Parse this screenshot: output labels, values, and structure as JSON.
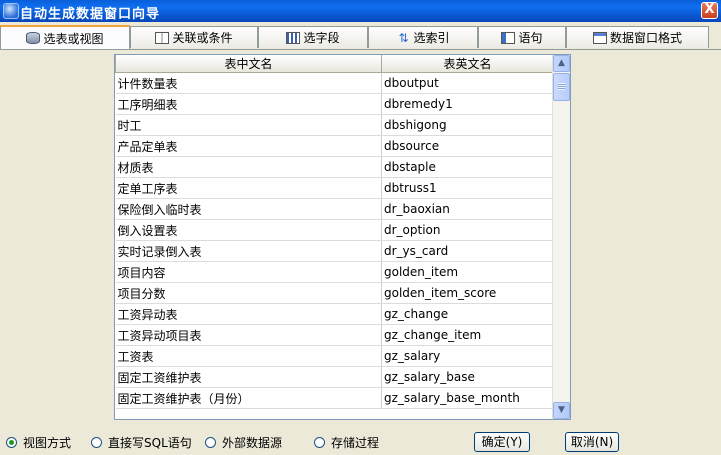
{
  "window": {
    "title": "自动生成数据窗口向导",
    "close_label": "X"
  },
  "tabs": [
    {
      "label": "选表或视图",
      "icon": "database-icon"
    },
    {
      "label": "关联或条件",
      "icon": "grid-icon"
    },
    {
      "label": "选字段",
      "icon": "columns-icon"
    },
    {
      "label": "选索引",
      "icon": "sort-icon"
    },
    {
      "label": "语句",
      "icon": "document-icon"
    },
    {
      "label": "数据窗口格式",
      "icon": "window-icon"
    }
  ],
  "table": {
    "headers": [
      "表中文名",
      "表英文名"
    ],
    "rows": [
      [
        "计件数量表",
        "dboutput"
      ],
      [
        "工序明细表",
        "dbremedy1"
      ],
      [
        "时工",
        "dbshigong"
      ],
      [
        "产品定单表",
        "dbsource"
      ],
      [
        "材质表",
        "dbstaple"
      ],
      [
        "定单工序表",
        "dbtruss1"
      ],
      [
        "保险倒入临时表",
        "dr_baoxian"
      ],
      [
        "倒入设置表",
        "dr_option"
      ],
      [
        "实时记录倒入表",
        "dr_ys_card"
      ],
      [
        "项目内容",
        "golden_item"
      ],
      [
        "项目分数",
        "golden_item_score"
      ],
      [
        "工资异动表",
        "gz_change"
      ],
      [
        "工资异动项目表",
        "gz_change_item"
      ],
      [
        "工资表",
        "gz_salary"
      ],
      [
        "固定工资维护表",
        "gz_salary_base"
      ],
      [
        "固定工资维护表（月份）",
        "gz_salary_base_month"
      ]
    ]
  },
  "modes": {
    "selected": 0,
    "options": [
      "视图方式",
      "直接写SQL语句",
      "外部数据源",
      "存储过程"
    ]
  },
  "buttons": {
    "ok": "确定(Y)",
    "cancel": "取消(N)"
  }
}
